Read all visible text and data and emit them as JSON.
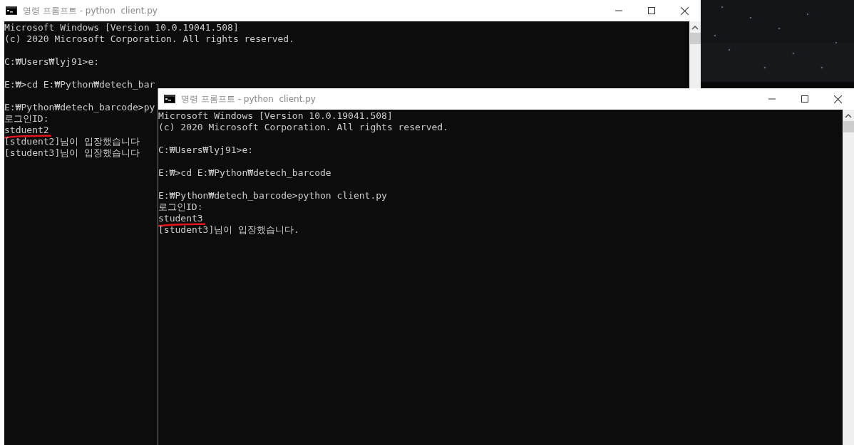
{
  "windows": [
    {
      "title": "명령 프롬프트 - python  client.py",
      "lines": [
        {
          "kind": "text",
          "text": "Microsoft Windows [Version 10.0.19041.508]"
        },
        {
          "kind": "text",
          "text": "(c) 2020 Microsoft Corporation. All rights reserved."
        },
        {
          "kind": "blank"
        },
        {
          "kind": "text",
          "text": "C:₩Users₩lyj91>e:"
        },
        {
          "kind": "blank"
        },
        {
          "kind": "text",
          "text": "E:₩>cd E:₩Python₩detech_bar"
        },
        {
          "kind": "blank"
        },
        {
          "kind": "text",
          "text": "E:₩Python₩detech_barcode>py"
        },
        {
          "kind": "text",
          "text": "로그인ID:"
        },
        {
          "kind": "text",
          "text": "stduent2",
          "underlined": true
        },
        {
          "kind": "text",
          "text": "[stduent2]님이 입장했습니다"
        },
        {
          "kind": "text",
          "text": "[student3]님이 입장했습니다"
        }
      ]
    },
    {
      "title": "명령 프롬프트 - python  client.py",
      "lines": [
        {
          "kind": "text",
          "text": "Microsoft Windows [Version 10.0.19041.508]"
        },
        {
          "kind": "text",
          "text": "(c) 2020 Microsoft Corporation. All rights reserved."
        },
        {
          "kind": "blank"
        },
        {
          "kind": "text",
          "text": "C:₩Users₩lyj91>e:"
        },
        {
          "kind": "blank"
        },
        {
          "kind": "text",
          "text": "E:₩>cd E:₩Python₩detech_barcode"
        },
        {
          "kind": "blank"
        },
        {
          "kind": "text",
          "text": "E:₩Python₩detech_barcode>python client.py"
        },
        {
          "kind": "text",
          "text": "로그인ID:"
        },
        {
          "kind": "text",
          "text": "student3",
          "underlined": true
        },
        {
          "kind": "text",
          "text": "[student3]님이 입장했습니다."
        }
      ]
    }
  ]
}
